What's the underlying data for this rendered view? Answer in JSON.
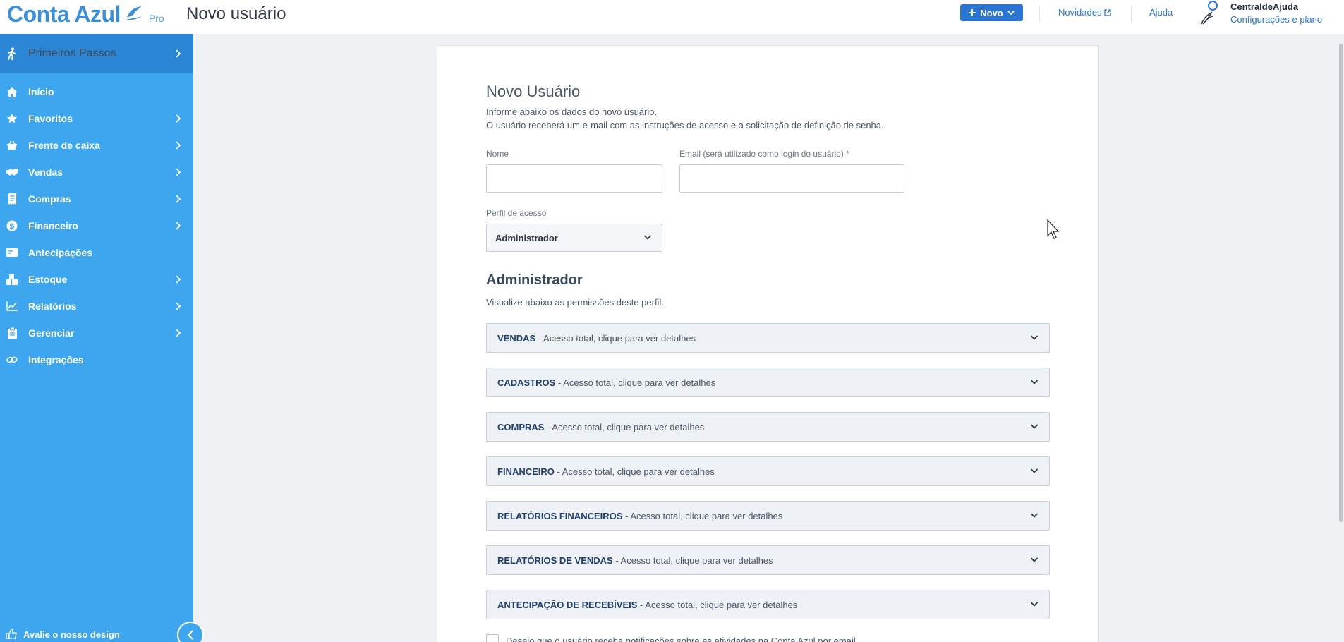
{
  "header": {
    "logo_text": "Conta Azul",
    "logo_badge": "Pro",
    "page_title": "Novo usuário",
    "new_button_label": "Novo",
    "links": {
      "news": "Novidades",
      "help": "Ajuda"
    },
    "user": {
      "name": "CentraldeAjuda",
      "plan_link": "Configurações e plano"
    }
  },
  "sidebar": {
    "first_steps": "Primeiros Passos",
    "items": [
      {
        "label": "Início",
        "icon": "home-icon",
        "has_submenu": false
      },
      {
        "label": "Favoritos",
        "icon": "star-icon",
        "has_submenu": true
      },
      {
        "label": "Frente de caixa",
        "icon": "basket-icon",
        "has_submenu": true
      },
      {
        "label": "Vendas",
        "icon": "handshake-icon",
        "has_submenu": true
      },
      {
        "label": "Compras",
        "icon": "receipt-icon",
        "has_submenu": true
      },
      {
        "label": "Financeiro",
        "icon": "dollar-icon",
        "has_submenu": true
      },
      {
        "label": "Antecipações",
        "icon": "card-icon",
        "has_submenu": false
      },
      {
        "label": "Estoque",
        "icon": "boxes-icon",
        "has_submenu": true
      },
      {
        "label": "Relatórios",
        "icon": "chart-icon",
        "has_submenu": true
      },
      {
        "label": "Gerenciar",
        "icon": "clipboard-icon",
        "has_submenu": true
      },
      {
        "label": "Integrações",
        "icon": "link-icon",
        "has_submenu": false
      }
    ],
    "rate_design": "Avalie o nosso design"
  },
  "form": {
    "title": "Novo Usuário",
    "subtitle_1": "Informe abaixo os dados do novo usuário.",
    "subtitle_2": "O usuário receberá um e-mail com as instruções de acesso e a solicitação de definição de senha.",
    "name_label": "Nome",
    "name_value": "",
    "email_label": "Email (será utilizado como login do usuário) *",
    "email_value": "",
    "profile_label": "Perfil de acesso",
    "profile_value": "Administrador"
  },
  "profile": {
    "title": "Administrador",
    "subtitle": "Visualize abaixo as permissões deste perfil.",
    "permissions": [
      {
        "name": "VENDAS",
        "desc": " - Acesso total, clique para ver detalhes"
      },
      {
        "name": "CADASTROS",
        "desc": " - Acesso total, clique para ver detalhes"
      },
      {
        "name": "COMPRAS",
        "desc": " - Acesso total, clique para ver detalhes"
      },
      {
        "name": "FINANCEIRO",
        "desc": " - Acesso total, clique para ver detalhes"
      },
      {
        "name": "RELATÓRIOS FINANCEIROS",
        "desc": " - Acesso total, clique para ver detalhes"
      },
      {
        "name": "RELATÓRIOS DE VENDAS",
        "desc": " - Acesso total, clique para ver detalhes"
      },
      {
        "name": "ANTECIPAÇÃO DE RECEBÍVEIS",
        "desc": " - Acesso total, clique para ver detalhes"
      }
    ],
    "notify_label": "Desejo que o usuário receba notificações sobre as atividades na Conta Azul por email"
  },
  "colors": {
    "brand_blue": "#3b8fd6",
    "sidebar_bg": "#3da6ee",
    "sidebar_active": "#2c86d6",
    "primary_button": "#2b75d2"
  }
}
